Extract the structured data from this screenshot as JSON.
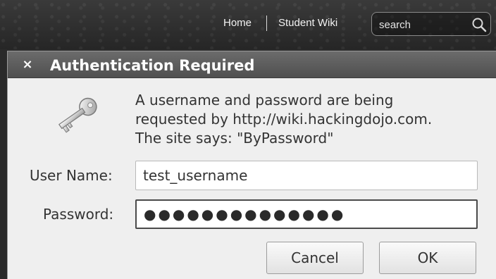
{
  "site": {
    "nav": {
      "home": "Home",
      "student_wiki": "Student Wiki"
    },
    "search": {
      "placeholder": "search",
      "icon": "search-icon"
    }
  },
  "dialog": {
    "close_label": "×",
    "title": "Authentication Required",
    "icon": "key-icon",
    "message_lines": [
      "A username and password are being",
      "requested by http://wiki.hackingdojo.com.",
      "The site says: \"ByPassword\""
    ],
    "username": {
      "label": "User Name:",
      "value": "test_username"
    },
    "password": {
      "label": "Password:",
      "masked_value": "●●●●●●●●●●●●●●"
    },
    "buttons": {
      "cancel": "Cancel",
      "ok": "OK"
    }
  }
}
